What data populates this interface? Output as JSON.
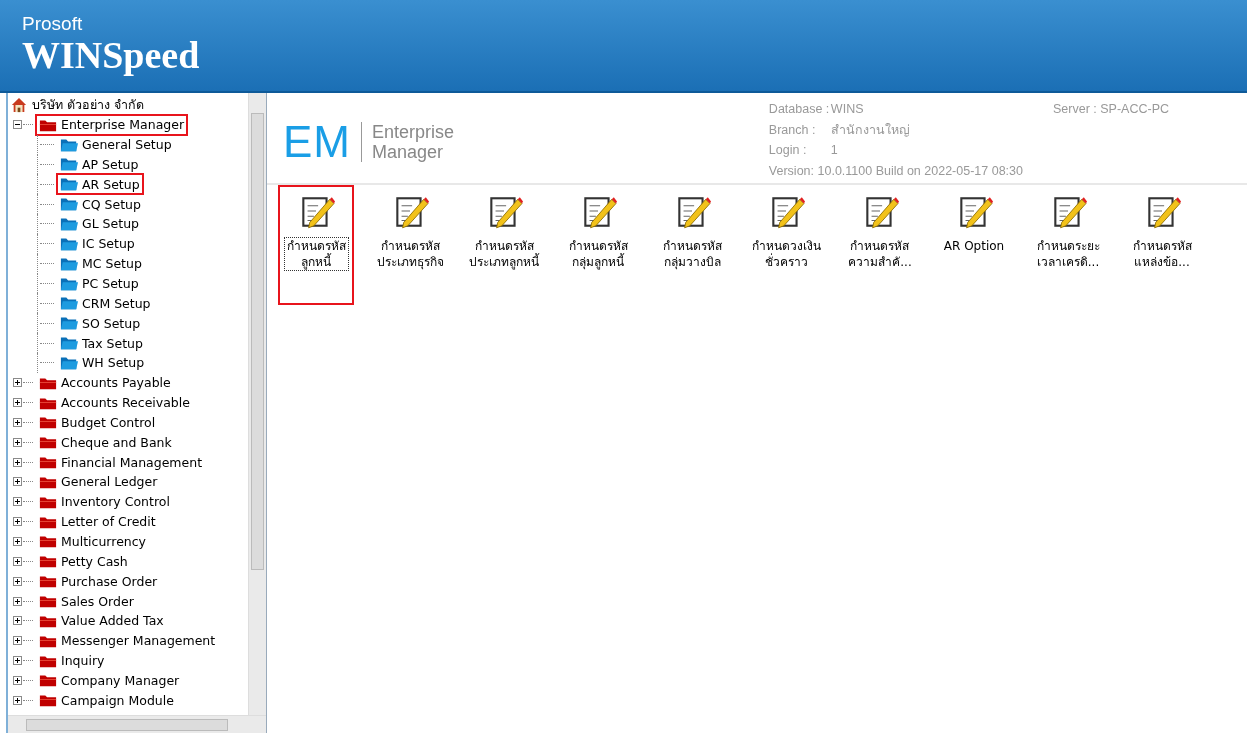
{
  "app_header": {
    "brand_top": "Prosoft",
    "brand_name": "WINSpeed"
  },
  "tree": {
    "root": {
      "label": "บริษัท ตัวอย่าง จำกัด",
      "children": [
        {
          "label": "Enterprise Manager",
          "expanded": true,
          "highlighted": true,
          "children": [
            {
              "label": "General Setup",
              "highlighted": false
            },
            {
              "label": "AP Setup",
              "highlighted": false
            },
            {
              "label": "AR Setup",
              "highlighted": true
            },
            {
              "label": "CQ Setup",
              "highlighted": false
            },
            {
              "label": "GL Setup",
              "highlighted": false
            },
            {
              "label": "IC Setup",
              "highlighted": false
            },
            {
              "label": "MC Setup",
              "highlighted": false
            },
            {
              "label": "PC Setup",
              "highlighted": false
            },
            {
              "label": "CRM Setup",
              "highlighted": false
            },
            {
              "label": "SO Setup",
              "highlighted": false
            },
            {
              "label": "Tax Setup",
              "highlighted": false
            },
            {
              "label": "WH Setup",
              "highlighted": false
            }
          ]
        },
        {
          "label": "Accounts Payable",
          "expanded": false,
          "highlighted": false
        },
        {
          "label": "Accounts Receivable",
          "expanded": false,
          "highlighted": false
        },
        {
          "label": "Budget Control",
          "expanded": false,
          "highlighted": false
        },
        {
          "label": "Cheque and Bank",
          "expanded": false,
          "highlighted": false
        },
        {
          "label": "Financial Management",
          "expanded": false,
          "highlighted": false
        },
        {
          "label": "General Ledger",
          "expanded": false,
          "highlighted": false
        },
        {
          "label": "Inventory Control",
          "expanded": false,
          "highlighted": false
        },
        {
          "label": "Letter of Credit",
          "expanded": false,
          "highlighted": false
        },
        {
          "label": "Multicurrency",
          "expanded": false,
          "highlighted": false
        },
        {
          "label": "Petty Cash",
          "expanded": false,
          "highlighted": false
        },
        {
          "label": "Purchase Order",
          "expanded": false,
          "highlighted": false
        },
        {
          "label": "Sales Order",
          "expanded": false,
          "highlighted": false
        },
        {
          "label": "Value Added Tax",
          "expanded": false,
          "highlighted": false
        },
        {
          "label": "Messenger Management",
          "expanded": false,
          "highlighted": false
        },
        {
          "label": "Inquiry",
          "expanded": false,
          "highlighted": false
        },
        {
          "label": "Company Manager",
          "expanded": false,
          "highlighted": false
        },
        {
          "label": "Campaign Module",
          "expanded": false,
          "highlighted": false
        }
      ]
    }
  },
  "module_header": {
    "logo": "EM",
    "title_lines": [
      "Enterprise",
      "Manager"
    ],
    "info": [
      {
        "label": "Database :",
        "value": "WINS"
      },
      {
        "label": "Branch :",
        "value": "สำนักงานใหญ่"
      },
      {
        "label": "Login :",
        "value": "1"
      }
    ],
    "server": "Server : SP-ACC-PC",
    "version": "Version: 10.0.1100  Build on 2022-05-17 08:30"
  },
  "icons": [
    {
      "lines": [
        "กำหนดรหัส",
        "ลูกหนี้"
      ],
      "selected": true,
      "highlighted": true
    },
    {
      "lines": [
        "กำหนดรหัส",
        "ประเภทธุรกิจ"
      ],
      "selected": false,
      "highlighted": false
    },
    {
      "lines": [
        "กำหนดรหัส",
        "ประเภทลูกหนี้"
      ],
      "selected": false,
      "highlighted": false
    },
    {
      "lines": [
        "กำหนดรหัส",
        "กลุ่มลูกหนี้"
      ],
      "selected": false,
      "highlighted": false
    },
    {
      "lines": [
        "กำหนดรหัส",
        "กลุ่มวางบิล"
      ],
      "selected": false,
      "highlighted": false
    },
    {
      "lines": [
        "กำหนดวงเงิน",
        "ชั่วคราว"
      ],
      "selected": false,
      "highlighted": false
    },
    {
      "lines": [
        "กำหนดรหัส",
        "ความสำคั..."
      ],
      "selected": false,
      "highlighted": false
    },
    {
      "lines": [
        "AR Option"
      ],
      "selected": false,
      "highlighted": false
    },
    {
      "lines": [
        "กำหนดระยะ",
        "เวลาเครดิ..."
      ],
      "selected": false,
      "highlighted": false
    },
    {
      "lines": [
        "กำหนดรหัส",
        "แหล่งข้อ..."
      ],
      "selected": false,
      "highlighted": false
    }
  ]
}
